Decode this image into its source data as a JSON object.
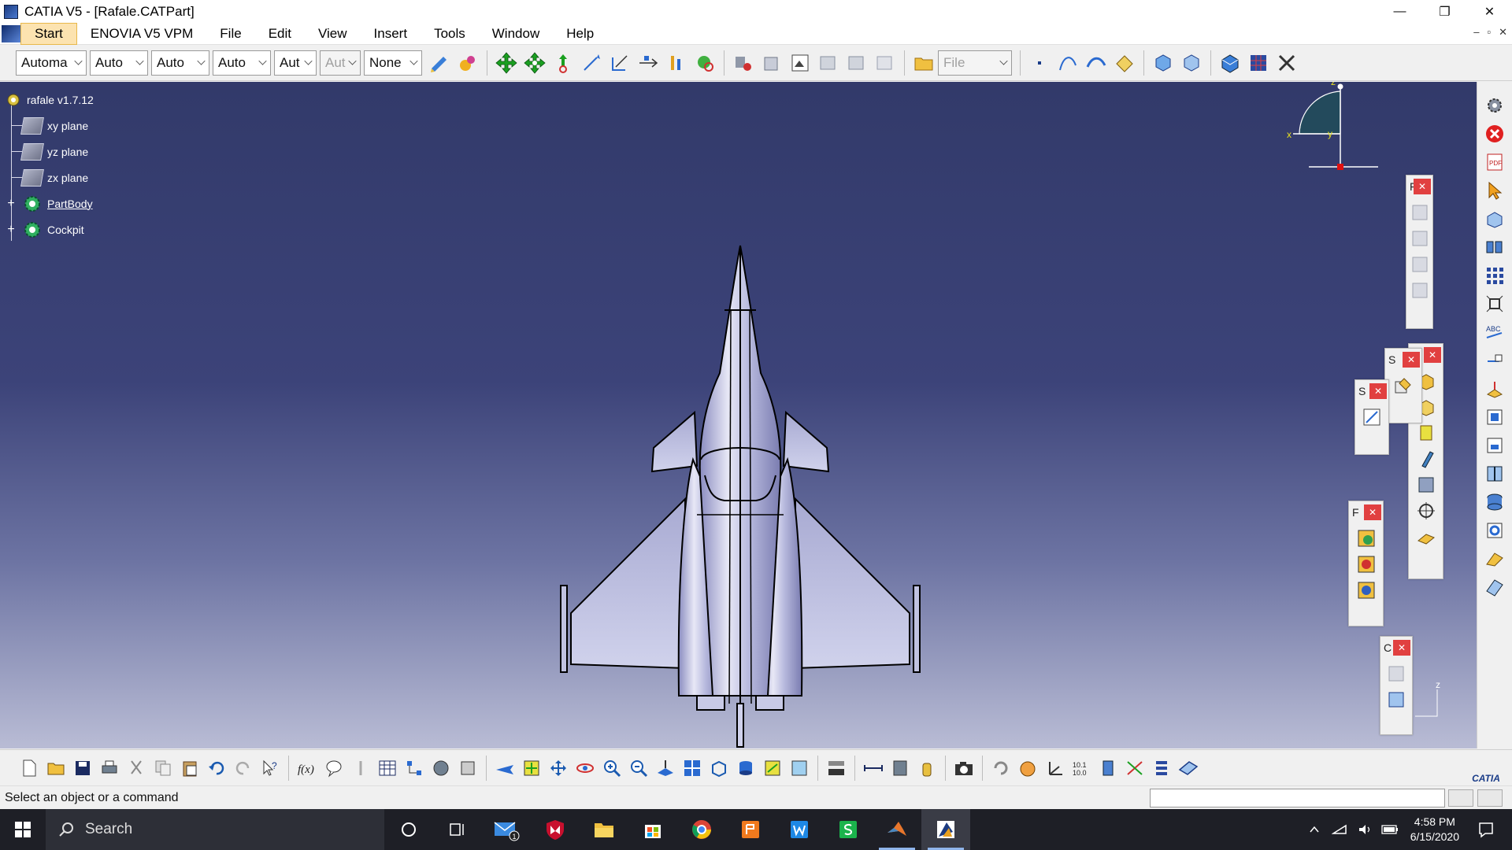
{
  "window": {
    "title": "CATIA V5 - [Rafale.CATPart]",
    "minimize": "—",
    "restore": "❐",
    "close": "✕"
  },
  "menu": {
    "items": [
      {
        "label": "Start"
      },
      {
        "label": "ENOVIA V5 VPM"
      },
      {
        "label": "File"
      },
      {
        "label": "Edit"
      },
      {
        "label": "View"
      },
      {
        "label": "Insert"
      },
      {
        "label": "Tools"
      },
      {
        "label": "Window"
      },
      {
        "label": "Help"
      }
    ],
    "mdi": [
      "–",
      "▫",
      "✕"
    ]
  },
  "toolbar_top": {
    "combos": [
      {
        "value": "Automa"
      },
      {
        "value": "Auto"
      },
      {
        "value": "Auto"
      },
      {
        "value": "Auto"
      },
      {
        "value": "Aut"
      },
      {
        "value": "Aut"
      },
      {
        "value": "None"
      }
    ],
    "file_combo": "File"
  },
  "tree": {
    "root": "rafale v1.7.12",
    "items": [
      {
        "label": "xy plane"
      },
      {
        "label": "yz plane"
      },
      {
        "label": "zx plane"
      },
      {
        "label": "PartBody"
      },
      {
        "label": "Cockpit"
      }
    ]
  },
  "compass": {
    "z": "z",
    "x": "x",
    "y": "y"
  },
  "axis_mini": {
    "z": "z"
  },
  "floating_toolbars": {
    "t1": {
      "head": "F",
      "close": "✕"
    },
    "t2": {
      "head": "S",
      "close": "✕"
    },
    "t3": {
      "head": "S",
      "close": "✕"
    },
    "t4": {
      "head": "F",
      "close": "✕"
    },
    "t5": {
      "head": "C",
      "close": "✕"
    },
    "t6": {
      "close": "✕"
    }
  },
  "status": {
    "message": "Select an object or a command"
  },
  "catia_logo": "CATIA",
  "taskbar": {
    "search_placeholder": "Search",
    "mail_badge": "1",
    "time": "4:58 PM",
    "date": "6/15/2020"
  },
  "colors": {
    "viewport_top": "#323a6a",
    "viewport_bottom": "#b9bcd5",
    "start_highlight": "#fce3b0",
    "close_red": "#e14040"
  }
}
